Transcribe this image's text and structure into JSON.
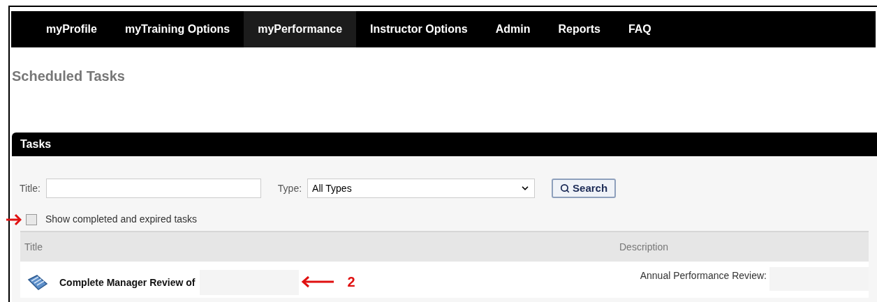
{
  "nav": [
    {
      "label": "myProfile",
      "selected": false
    },
    {
      "label": "myTraining Options",
      "selected": false
    },
    {
      "label": "myPerformance",
      "selected": true
    },
    {
      "label": "Instructor Options",
      "selected": false
    },
    {
      "label": "Admin",
      "selected": false
    },
    {
      "label": "Reports",
      "selected": false
    },
    {
      "label": "FAQ",
      "selected": false
    }
  ],
  "page_title": "Scheduled Tasks",
  "panel": {
    "title": "Tasks",
    "filters": {
      "title_label": "Title:",
      "type_label": "Type:",
      "type_value": "All Types",
      "search_button": "Search"
    },
    "show_completed": {
      "label": "Show completed and expired tasks",
      "checked": false,
      "arrow": true
    },
    "table": {
      "columns": [
        "Title",
        "Description"
      ],
      "rows": [
        {
          "title": "Complete Manager Review of",
          "description": "Annual Performance Review:",
          "annotation": "2"
        }
      ]
    }
  }
}
